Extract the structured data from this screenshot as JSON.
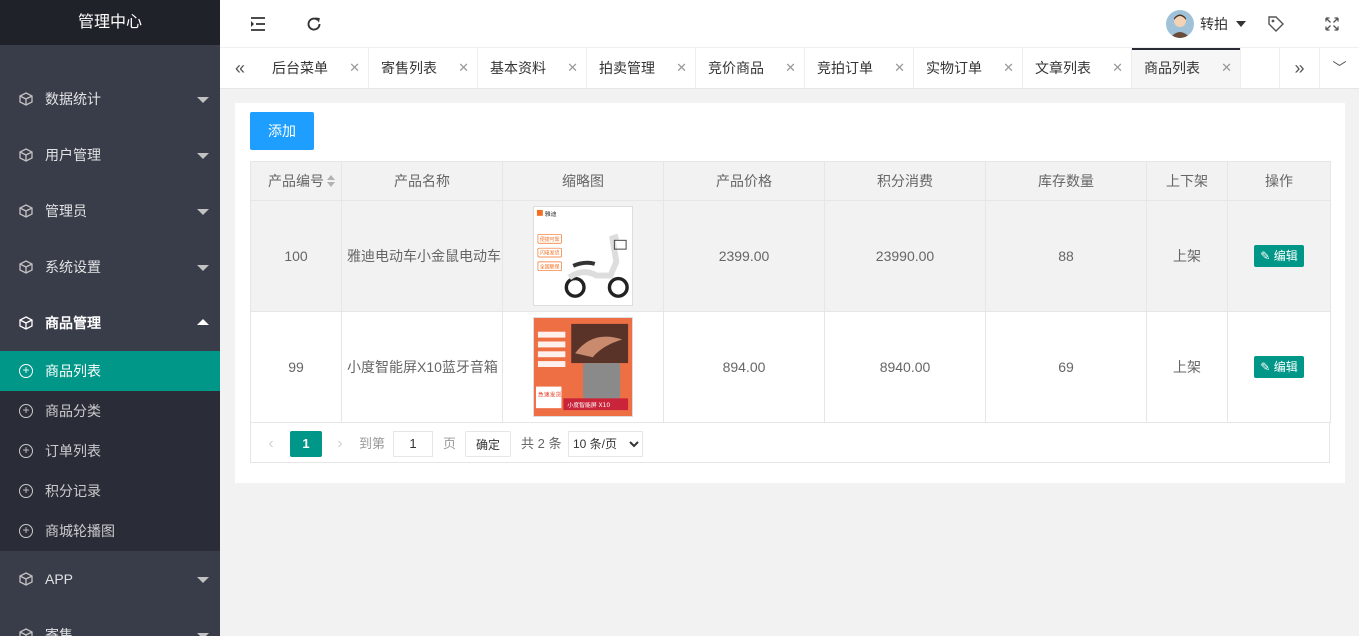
{
  "sidebar": {
    "title": "管理中心",
    "items": [
      {
        "label": "数据统计"
      },
      {
        "label": "用户管理"
      },
      {
        "label": "管理员"
      },
      {
        "label": "系统设置"
      },
      {
        "label": "商品管理"
      }
    ],
    "subitems": [
      {
        "label": "商品列表"
      },
      {
        "label": "商品分类"
      },
      {
        "label": "订单列表"
      },
      {
        "label": "积分记录"
      },
      {
        "label": "商城轮播图"
      }
    ],
    "bottom_items": [
      {
        "label": "APP"
      },
      {
        "label": "寄售"
      }
    ]
  },
  "header": {
    "user_name": "转拍"
  },
  "tabs": [
    {
      "label": "后台菜单"
    },
    {
      "label": "寄售列表"
    },
    {
      "label": "基本资料"
    },
    {
      "label": "拍卖管理"
    },
    {
      "label": "竞价商品"
    },
    {
      "label": "竞拍订单"
    },
    {
      "label": "实物订单"
    },
    {
      "label": "文章列表"
    },
    {
      "label": "商品列表"
    }
  ],
  "toolbar": {
    "add_label": "添加"
  },
  "table": {
    "columns": [
      "产品编号",
      "产品名称",
      "缩略图",
      "产品价格",
      "积分消费",
      "库存数量",
      "上下架",
      "操作"
    ],
    "rows": [
      {
        "id": "100",
        "name": "雅迪电动车小金鼠电动车",
        "price": "2399.00",
        "points": "23990.00",
        "stock": "88",
        "status": "上架",
        "action": "编辑",
        "thumb_tags": [
          "雅迪",
          "便捷可靠",
          "闪电发货",
          "全国联保"
        ]
      },
      {
        "id": "99",
        "name": "小度智能屏X10蓝牙音箱",
        "price": "894.00",
        "points": "8940.00",
        "stock": "69",
        "status": "上架",
        "action": "编辑",
        "thumb_tags": [
          "急速发货",
          "小度智能屏 X10"
        ]
      }
    ]
  },
  "pager": {
    "current": "1",
    "goto_label": "到第",
    "goto_value": "1",
    "page_unit": "页",
    "ok_label": "确定",
    "total": "共 2 条",
    "size_option": "10 条/页"
  },
  "colors": {
    "sidebar_bg": "#393d49",
    "active": "#009688",
    "primary": "#1e9fff"
  }
}
